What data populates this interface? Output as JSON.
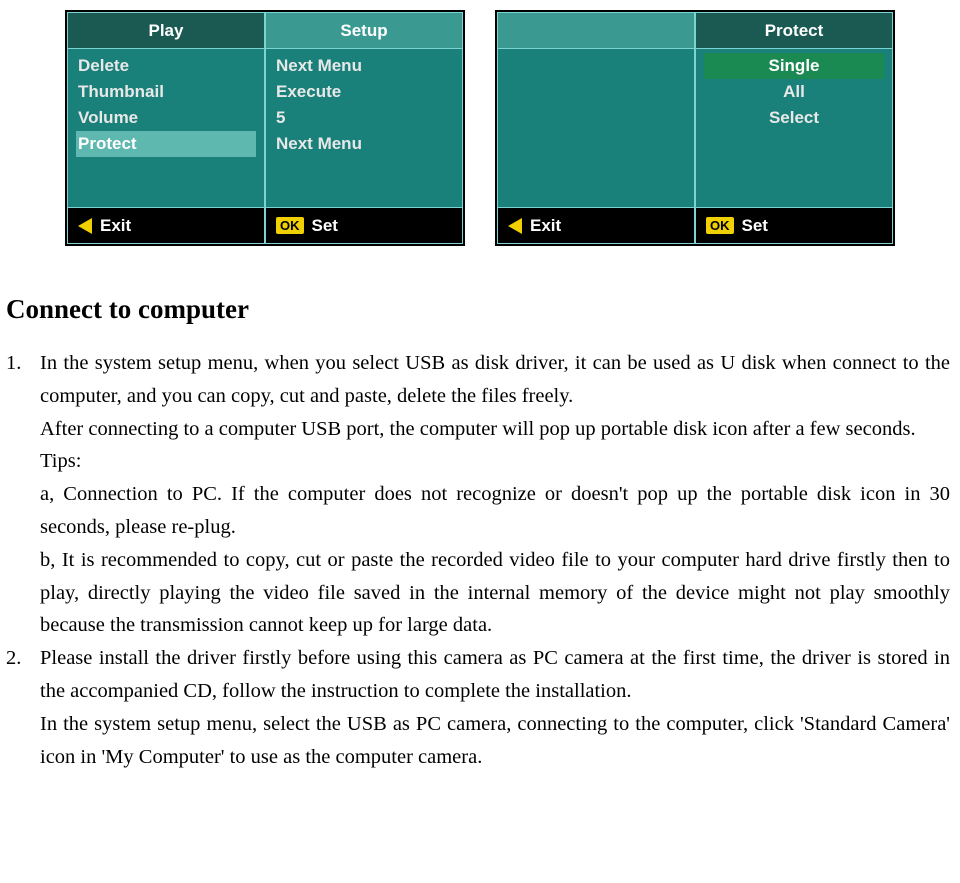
{
  "screen1": {
    "tabs": {
      "play": "Play",
      "setup": "Setup"
    },
    "left": {
      "delete": "Delete",
      "thumbnail": "Thumbnail",
      "volume": "Volume",
      "protect": "Protect"
    },
    "right": {
      "nextmenu1": "Next Menu",
      "execute": "Execute",
      "five": "5",
      "nextmenu2": "Next Menu"
    },
    "footer": {
      "exit": "Exit",
      "ok": "OK",
      "set": "Set"
    }
  },
  "screen2": {
    "tabs": {
      "blank": "",
      "protect": "Protect"
    },
    "left": {
      "blank": ""
    },
    "right": {
      "single": "Single",
      "all": "All",
      "select": "Select"
    },
    "footer": {
      "exit": "Exit",
      "ok": "OK",
      "set": "Set"
    }
  },
  "heading": "Connect to computer",
  "body": {
    "n1": "1.",
    "p1a": "In the system setup menu, when you select USB as disk driver, it can be used as U disk when connect to the computer, and you can copy, cut and paste, delete the files freely.",
    "p1b": "After connecting to a computer USB port, the computer will pop up portable disk icon after a few seconds.",
    "p1c": "Tips:",
    "p1d": "a, Connection to PC. If the computer does not recognize or doesn't pop up the portable disk icon in 30 seconds, please re-plug.",
    "p1e": "b, It is recommended to copy, cut or paste the recorded video file to your computer hard drive firstly then to play, directly playing the video file saved in the internal memory of the device might not play smoothly because the transmission cannot keep up for large data.",
    "n2": "2.",
    "p2a": "Please install the driver firstly before using this camera as PC camera at the first time, the driver is stored in the accompanied CD, follow the instruction to complete the installation.",
    "p2b": "In the system setup menu, select the USB as PC camera, connecting to the computer, click 'Standard Camera' icon in 'My Computer' to use as the computer camera."
  }
}
